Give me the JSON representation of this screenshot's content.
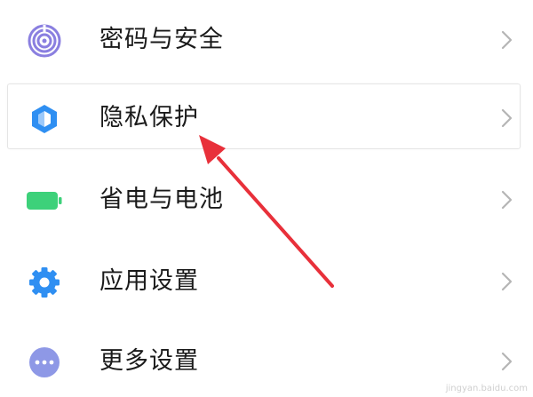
{
  "settings": {
    "items": [
      {
        "label": "密码与安全",
        "icon": "fingerprint-icon",
        "icon_color": "#8a7fe0"
      },
      {
        "label": "隐私保护",
        "icon": "privacy-shield-icon",
        "icon_color": "#2f8ff2"
      },
      {
        "label": "省电与电池",
        "icon": "battery-icon",
        "icon_color": "#3dd17a"
      },
      {
        "label": "应用设置",
        "icon": "gear-icon",
        "icon_color": "#2f8ff2"
      },
      {
        "label": "更多设置",
        "icon": "more-dots-icon",
        "icon_color": "#8e98e6"
      }
    ],
    "chevron_color": "#b5b5b5",
    "highlighted_index": 1
  },
  "annotation": {
    "arrow_color": "#e8303a",
    "target": "隐私保护"
  },
  "watermark": {
    "text": "jingyan.baidu.com"
  }
}
